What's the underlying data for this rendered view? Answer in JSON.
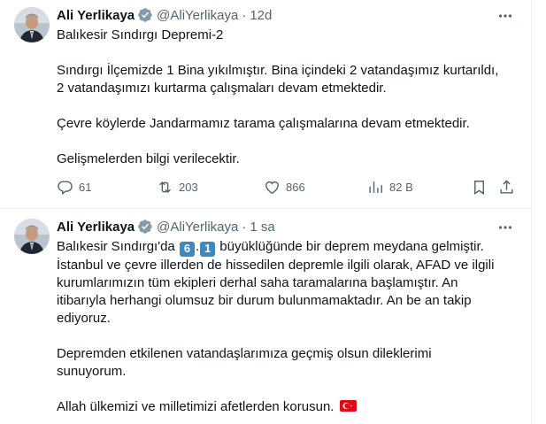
{
  "colors": {
    "text": "#0f1419",
    "muted": "#536471",
    "verified": "#829aab",
    "border": "#eff3f4",
    "keycap": "#3b88c3",
    "flag": "#e30a17"
  },
  "tweets": [
    {
      "name": "Ali Yerlikaya",
      "handle": "@AliYerlikaya",
      "separator": "·",
      "time": "12d",
      "paragraphs": [
        [
          "Balıkesir Sındırgı Depremi-2"
        ],
        [
          "Sındırgı İlçemizde 1 Bina yıkılmıştır. Bina içindeki 2 vatandaşımız kurtarıldı,",
          "2 vatandaşımızı kurtarma çalışmaları devam etmektedir."
        ],
        [
          "Çevre köylerde Jandarmamız tarama çalışmalarına devam etmektedir."
        ],
        [
          "Gelişmelerden bilgi verilecektir."
        ]
      ],
      "actions": {
        "replies": "61",
        "reposts": "203",
        "likes": "866",
        "views": "82 B"
      }
    },
    {
      "name": "Ali Yerlikaya",
      "handle": "@AliYerlikaya",
      "separator": "·",
      "time": "1 sa",
      "line1_prefix": "Balıkesir Sındırgı'da",
      "magnitude_digit1": "6",
      "magnitude_dot": ".",
      "magnitude_digit2": "1",
      "line1_suffix": "büyüklüğünde bir deprem meydana gelmiştir.",
      "paragraph1_rest": [
        "İstanbul ve çevre illerden de hissedilen depremle ilgili olarak, AFAD ve ilgili",
        "kurumlarımızın tüm ekipleri derhal saha taramalarına başlamıştır. An",
        "itibarıyla herhangi olumsuz bir durum bulunmamaktadır. An be an takip",
        "ediyoruz."
      ],
      "paragraph2": [
        "Depremden etkilenen vatandaşlarımıza geçmiş olsun dileklerimi",
        "sunuyorum."
      ],
      "paragraph3": "Allah ülkemizi ve milletimizi afetlerden korusun.",
      "flag_icon": "turkey-flag-icon"
    }
  ]
}
